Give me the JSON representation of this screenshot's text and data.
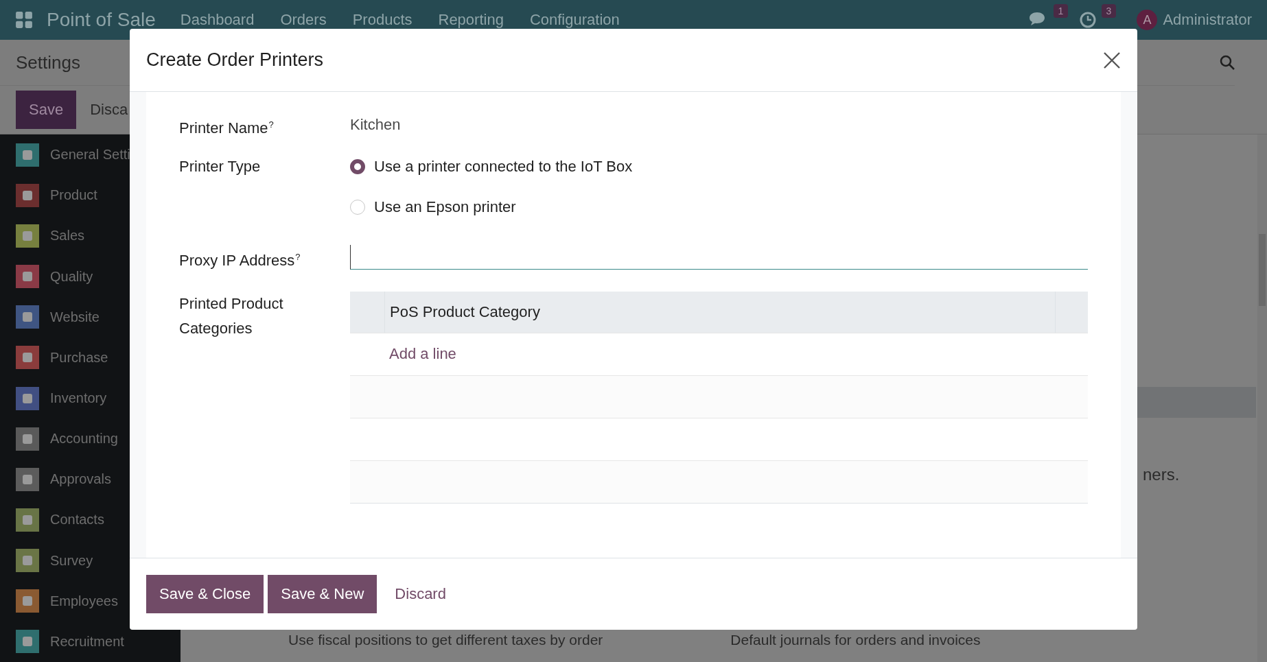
{
  "navbar": {
    "app_name": "Point of Sale",
    "menus": [
      "Dashboard",
      "Orders",
      "Products",
      "Reporting",
      "Configuration"
    ],
    "messages_badge": "1",
    "activities_badge": "3",
    "user": {
      "initial": "A",
      "name": "Administrator"
    }
  },
  "control_panel": {
    "title": "Settings",
    "save": "Save",
    "discard": "Disca"
  },
  "sidebar": {
    "items": [
      {
        "label": "General Setti",
        "color": "#2f6e6e"
      },
      {
        "label": "Product",
        "color": "#6b2e2e"
      },
      {
        "label": "Sales",
        "color": "#77803f"
      },
      {
        "label": "Quality",
        "color": "#8a3a46"
      },
      {
        "label": "Website",
        "color": "#3f5582"
      },
      {
        "label": "Purchase",
        "color": "#8a3c3c"
      },
      {
        "label": "Inventory",
        "color": "#414f82"
      },
      {
        "label": "Accounting",
        "color": "#5a5a5a"
      },
      {
        "label": "Approvals",
        "color": "#5c5c5c"
      },
      {
        "label": "Contacts",
        "color": "#687446"
      },
      {
        "label": "Survey",
        "color": "#6a7546"
      },
      {
        "label": "Employees",
        "color": "#8a5a32"
      },
      {
        "label": "Recruitment",
        "color": "#2f6e6e"
      }
    ]
  },
  "background": {
    "side_text": "ners.",
    "bottom_texts": [
      "Use fiscal positions to get different taxes by order",
      "Default journals for orders and invoices"
    ]
  },
  "dialog": {
    "title": "Create Order Printers",
    "fields": [
      {
        "kind": "text",
        "label": "Printer Name",
        "help": "?",
        "value": "Kitchen"
      },
      {
        "kind": "radio",
        "label": "Printer Type",
        "options": [
          {
            "label": "Use a printer connected to the IoT Box",
            "selected": true
          },
          {
            "label": "Use an Epson printer",
            "selected": false
          }
        ]
      },
      {
        "kind": "input",
        "label": "Proxy IP Address",
        "help": "?"
      },
      {
        "kind": "table",
        "label": "Printed Product Categories",
        "columns": [
          "PoS Product Category"
        ],
        "add_line": "Add a line"
      }
    ],
    "buttons": [
      {
        "label": "Save & Close",
        "kind": "primary"
      },
      {
        "label": "Save & New",
        "kind": "primary"
      },
      {
        "label": "Discard",
        "kind": "link"
      }
    ]
  }
}
